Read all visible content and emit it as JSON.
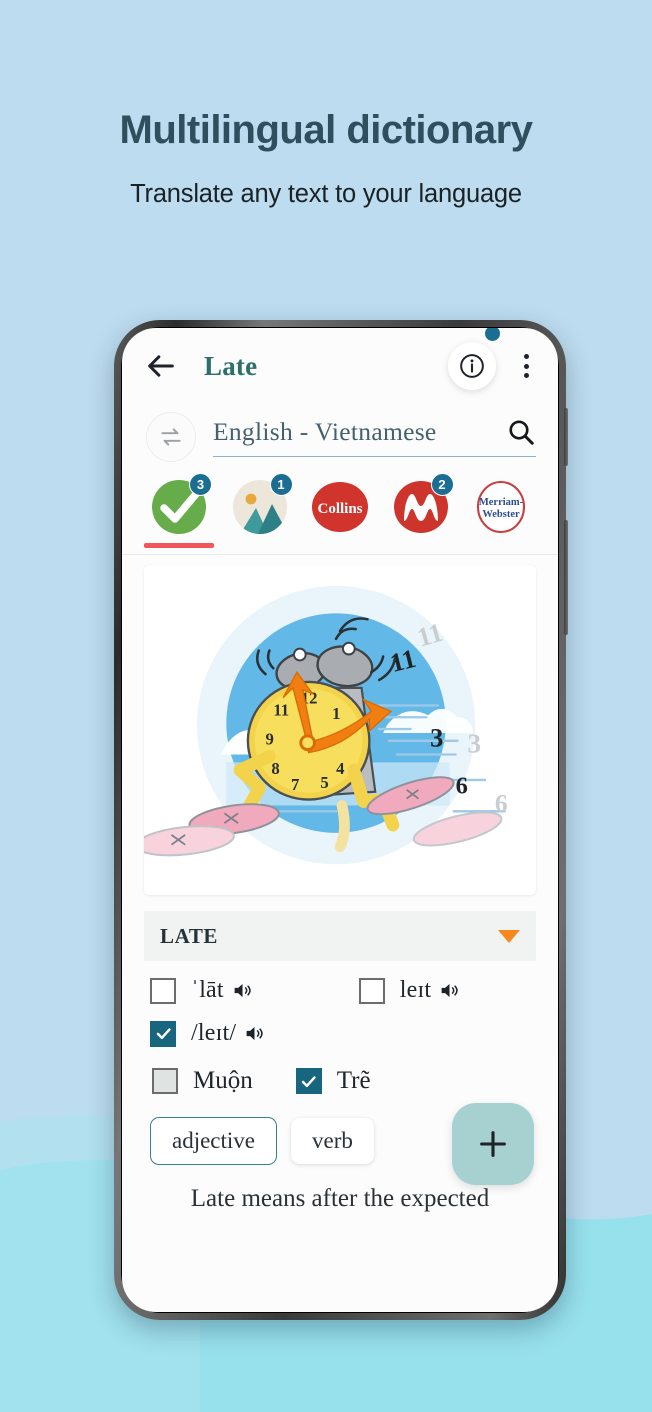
{
  "promo": {
    "title": "Multilingual dictionary",
    "subtitle": "Translate any text to your language"
  },
  "colors": {
    "background": "#bddcef",
    "wave": "#95e0ec",
    "accent_teal": "#1b6e91",
    "app_title": "#2c6f6b",
    "tab_indicator": "#f2555a",
    "caret_orange": "#f5881f",
    "fab": "#a7d0d1",
    "chip_border": "#3a7f91"
  },
  "appbar": {
    "back_icon": "arrow-left-icon",
    "title": "Late",
    "info_icon": "info-circle-icon",
    "notification_dot": true,
    "overflow_icon": "kebab-menu-icon"
  },
  "language_selector": {
    "swap_icon": "swap-arrows-icon",
    "value": "English - Vietnamese",
    "search_icon": "search-icon"
  },
  "source_tabs": [
    {
      "name": "check",
      "label": "Personal dictionary",
      "badge": "3",
      "selected": true
    },
    {
      "name": "image",
      "label": "Image dictionary",
      "badge": "1",
      "selected": false
    },
    {
      "name": "collins",
      "label": "Collins",
      "badge": "",
      "selected": false
    },
    {
      "name": "macmillan",
      "label": "Macmillan",
      "badge": "2",
      "selected": false
    },
    {
      "name": "merriam-webster",
      "label": "Merriam-Webster",
      "badge": "",
      "selected": false
    }
  ],
  "illustration": {
    "alt": "running alarm clock cartoon",
    "clock_numbers": [
      "12",
      "1",
      "3",
      "4",
      "5",
      "7",
      "8",
      "9"
    ],
    "floating_numbers": [
      "11",
      "11",
      "3",
      "3",
      "6",
      "6"
    ]
  },
  "word_section": {
    "headword": "LATE",
    "expand_icon": "caret-down-icon",
    "pronunciations": [
      {
        "text": "ˈlāt",
        "checked": false,
        "style": "outline",
        "speaker_icon": "speaker-icon"
      },
      {
        "text": "leɪt",
        "checked": false,
        "style": "outline",
        "speaker_icon": "speaker-icon"
      },
      {
        "text": "/leɪt/",
        "checked": true,
        "style": "filled",
        "speaker_icon": "speaker-icon"
      }
    ],
    "translations": [
      {
        "text": "Muộn",
        "checked": false,
        "style": "gray"
      },
      {
        "text": "Trẽ",
        "checked": true,
        "style": "filled"
      }
    ],
    "pos_chips": [
      {
        "label": "adjective",
        "selected": true
      },
      {
        "label": "verb",
        "selected": false
      }
    ],
    "add_button": {
      "icon": "plus-icon",
      "label": "+"
    },
    "definition": "Late means after the expected"
  }
}
